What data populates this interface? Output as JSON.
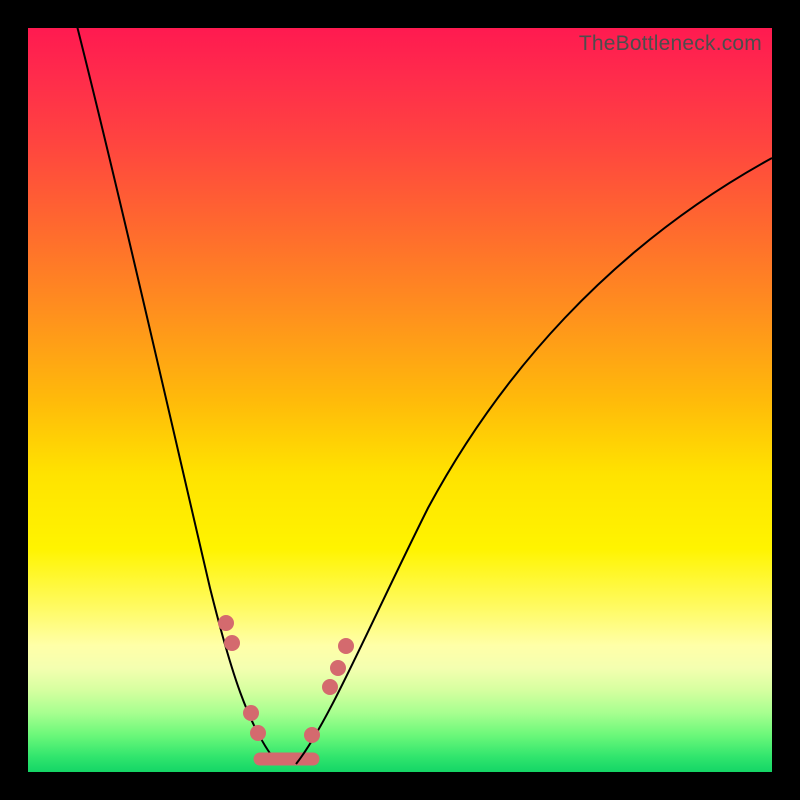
{
  "watermark": "TheBottleneck.com",
  "colors": {
    "frame": "#000000",
    "curve": "#000000",
    "marker": "#d46a6e"
  },
  "chart_data": {
    "type": "line",
    "title": "",
    "xlabel": "",
    "ylabel": "",
    "xlim": [
      0,
      100
    ],
    "ylim": [
      0,
      100
    ],
    "grid": false,
    "legend": false,
    "background": "heatmap-gradient-vertical red→green",
    "note": "V-shaped bottleneck curve; y is mismatch %, minimum near x≈34. Values estimated from pixel geometry.",
    "series": [
      {
        "name": "bottleneck-curve",
        "x": [
          0,
          5,
          10,
          15,
          20,
          25,
          28,
          30,
          32,
          34,
          36,
          38,
          40,
          45,
          50,
          55,
          60,
          65,
          70,
          75,
          80,
          85,
          90,
          95,
          100
        ],
        "y": [
          100,
          88,
          75,
          61,
          46,
          28,
          16,
          8,
          3,
          1,
          2,
          5,
          10,
          23,
          34,
          43,
          50,
          56,
          62,
          66,
          70,
          74,
          77,
          80,
          82
        ]
      }
    ],
    "markers": {
      "name": "highlighted-points",
      "stroke_segment_x": [
        30,
        39
      ],
      "points_x": [
        26.5,
        27.3,
        30.0,
        31.0,
        38.0,
        40.6,
        41.7,
        42.7
      ],
      "points_y": [
        20.1,
        17.3,
        8.0,
        5.5,
        5.0,
        11.3,
        14.0,
        16.9
      ]
    }
  }
}
